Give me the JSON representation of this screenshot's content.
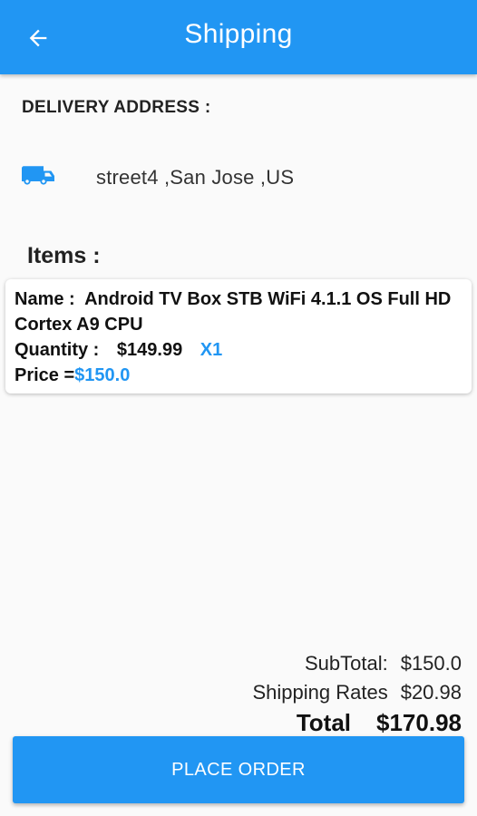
{
  "appbar": {
    "title": "Shipping",
    "back_icon": "arrow-back-icon"
  },
  "delivery": {
    "label": "DELIVERY ADDRESS :",
    "icon": "truck-icon",
    "address": "street4 ,San Jose ,US"
  },
  "items": {
    "label": "Items :",
    "list": [
      {
        "name_label": "Name :",
        "name": "Android TV Box STB WiFi 4.1.1 OS Full HD Cortex A9 CPU",
        "quantity_label": "Quantity :",
        "unit_price": "$149.99",
        "quantity": "X1",
        "price_label": "Price =",
        "price": "$150.0"
      }
    ]
  },
  "totals": {
    "subtotal_label": "SubTotal:",
    "subtotal": "$150.0",
    "shipping_label": "Shipping Rates",
    "shipping": "$20.98",
    "total_label": "Total",
    "total": "$170.98"
  },
  "actions": {
    "place_order": "PLACE ORDER"
  },
  "colors": {
    "primary": "#2196f3",
    "background": "#fafafa"
  }
}
